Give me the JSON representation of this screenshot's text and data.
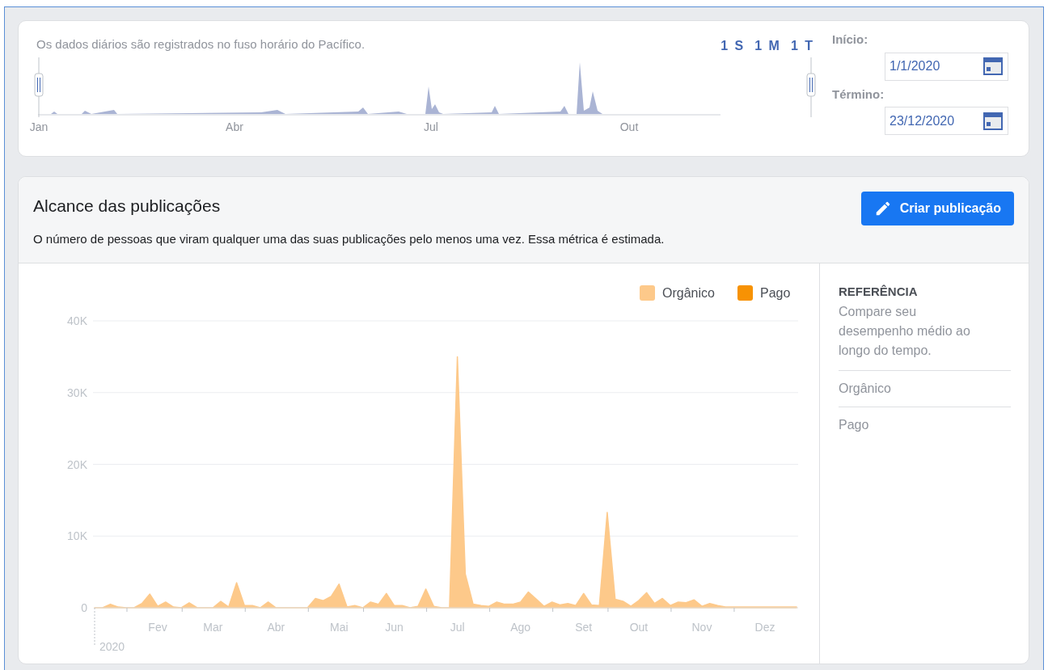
{
  "date_range": {
    "note": "Os dados diários são registrados no fuso horário do Pacífico.",
    "presets": [
      {
        "label": "1 S"
      },
      {
        "label": "1 M"
      },
      {
        "label": "1 T"
      }
    ],
    "axis_labels": [
      "Jan",
      "Abr",
      "Jul",
      "Out"
    ],
    "start": {
      "label": "Início:",
      "value": "1/1/2020"
    },
    "end": {
      "label": "Término:",
      "value": "23/12/2020"
    }
  },
  "reach_card": {
    "title": "Alcance das publicações",
    "description": "O número de pessoas que viram qualquer uma das suas publicações pelo menos uma vez. Essa métrica é estimada.",
    "create_button": "Criar publicação",
    "year_label": "2020",
    "chart_data": {
      "type": "area",
      "grid": true,
      "ylim": [
        0,
        40000
      ],
      "yticks": [
        0,
        {
          "value": 10000,
          "label": "10K"
        },
        {
          "value": 20000,
          "label": "20K"
        },
        {
          "value": 30000,
          "label": "30K"
        },
        {
          "value": 40000,
          "label": "40K"
        }
      ],
      "categories": [
        null,
        null,
        null,
        null,
        null,
        null,
        null,
        null,
        "Fev",
        null,
        null,
        null,
        null,
        null,
        null,
        "Mar",
        null,
        null,
        null,
        null,
        null,
        null,
        null,
        "Abr",
        null,
        null,
        null,
        null,
        null,
        null,
        null,
        "Mai",
        null,
        null,
        null,
        null,
        null,
        null,
        "Jun",
        null,
        null,
        null,
        null,
        null,
        null,
        null,
        "Jul",
        null,
        null,
        null,
        null,
        null,
        null,
        null,
        "Ago",
        null,
        null,
        null,
        null,
        null,
        null,
        null,
        "Set",
        null,
        null,
        null,
        null,
        null,
        null,
        "Out",
        null,
        null,
        null,
        null,
        null,
        null,
        null,
        "Nov",
        null,
        null,
        null,
        null,
        null,
        null,
        null,
        "Dez",
        null,
        null,
        null,
        null
      ],
      "series": [
        {
          "name": "Orgânico",
          "color": "#fdc98a",
          "values": [
            0,
            0,
            500,
            100,
            0,
            0,
            600,
            1900,
            200,
            800,
            100,
            0,
            700,
            0,
            0,
            0,
            900,
            100,
            3500,
            300,
            300,
            0,
            800,
            0,
            0,
            0,
            0,
            0,
            1300,
            1000,
            1600,
            3300,
            100,
            300,
            0,
            800,
            500,
            2000,
            300,
            300,
            0,
            200,
            2600,
            200,
            0,
            0,
            35000,
            4700,
            500,
            300,
            200,
            800,
            500,
            500,
            800,
            2200,
            1200,
            200,
            800,
            400,
            600,
            300,
            2000,
            400,
            300,
            13300,
            1200,
            900,
            200,
            1000,
            2100,
            600,
            1300,
            300,
            800,
            700,
            1100,
            200,
            600,
            300,
            100,
            100,
            100,
            100,
            100,
            100,
            100,
            100,
            100,
            100
          ]
        },
        {
          "name": "Pago",
          "color": "#f79203",
          "values": [
            null,
            null,
            null,
            null,
            null,
            null,
            null,
            null,
            null,
            null,
            null,
            null,
            null,
            null,
            null,
            null,
            null,
            null,
            null,
            null,
            null,
            null,
            null,
            null,
            null,
            null,
            null,
            null,
            null,
            null,
            null,
            null,
            null,
            null,
            null,
            null,
            null,
            null,
            null,
            null,
            null,
            null,
            null,
            null,
            null,
            null,
            null,
            null,
            null,
            null,
            null,
            null,
            null,
            null,
            null,
            null,
            null,
            null,
            null,
            null,
            null,
            null,
            null,
            null,
            null,
            null,
            null,
            null,
            null,
            null,
            null,
            null,
            null,
            null,
            null,
            null,
            null,
            null,
            null,
            null,
            null,
            null,
            null,
            null,
            null,
            null,
            null,
            null,
            null,
            null
          ]
        }
      ]
    },
    "reference": {
      "heading": "REFERÊNCIA",
      "description": "Compare seu desempenho médio ao longo do tempo.",
      "items": [
        "Orgânico",
        "Pago"
      ]
    }
  }
}
